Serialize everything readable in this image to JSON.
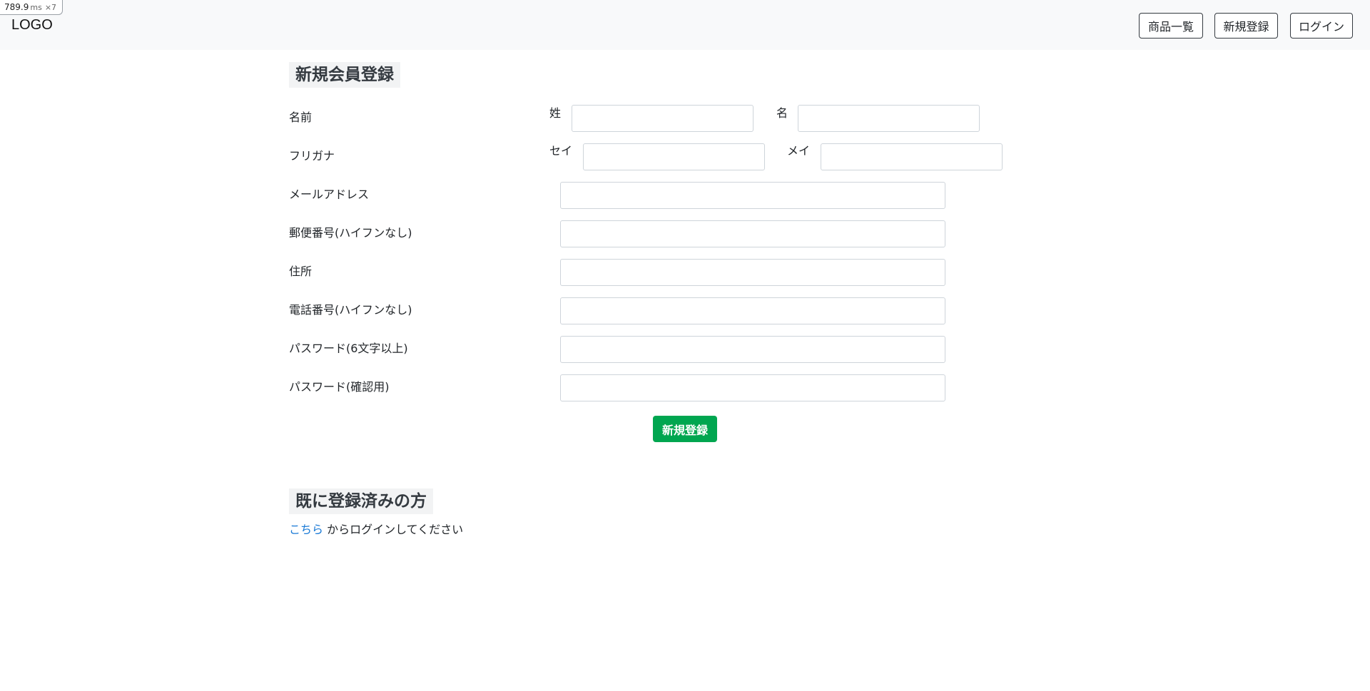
{
  "perf_badge": {
    "value": "789.9",
    "unit": "ms",
    "count": "×7"
  },
  "header": {
    "logo": "LOGO",
    "nav": {
      "products": "商品一覧",
      "register": "新規登録",
      "login": "ログイン"
    }
  },
  "registration": {
    "title": "新規会員登録",
    "fields": {
      "name": {
        "label": "名前",
        "last_label": "姓",
        "last_value": "",
        "first_label": "名",
        "first_value": ""
      },
      "furigana": {
        "label": "フリガナ",
        "last_label": "セイ",
        "last_value": "",
        "first_label": "メイ",
        "first_value": ""
      },
      "email": {
        "label": "メールアドレス",
        "value": ""
      },
      "postal_code": {
        "label": "郵便番号(ハイフンなし)",
        "value": ""
      },
      "address": {
        "label": "住所",
        "value": ""
      },
      "phone": {
        "label": "電話番号(ハイフンなし)",
        "value": ""
      },
      "password": {
        "label": "パスワード(6文字以上)",
        "value": ""
      },
      "password_confirm": {
        "label": "パスワード(確認用)",
        "value": ""
      }
    },
    "submit_label": "新規登録"
  },
  "existing": {
    "title": "既に登録済みの方",
    "link_text": "こちら",
    "suffix": " からログインしてください"
  },
  "colors": {
    "header_bg": "#f8f9fa",
    "submit_bg": "#00a650",
    "link": "#1a7ad6"
  }
}
